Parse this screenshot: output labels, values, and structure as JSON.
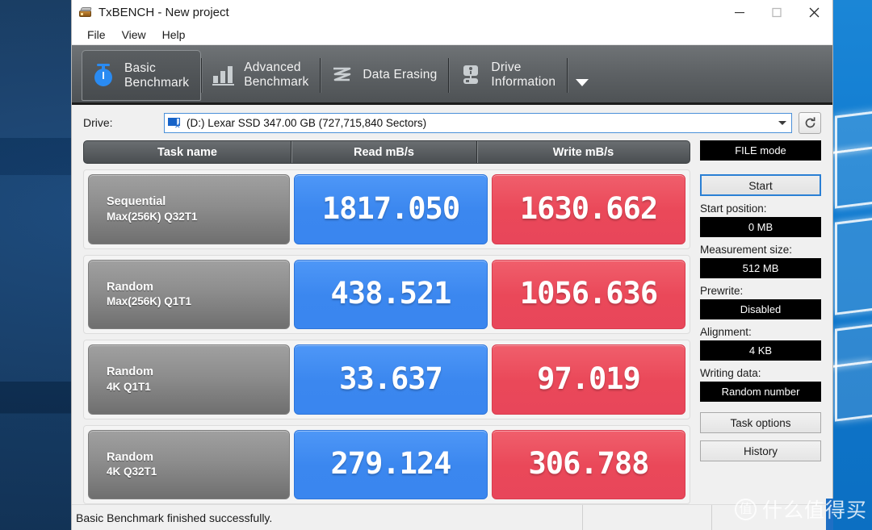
{
  "window": {
    "title": "TxBENCH - New project",
    "app_icon": "printer-drive-icon",
    "controls": {
      "minimize": "minimize-icon",
      "maximize": "maximize-icon",
      "close": "close-icon"
    }
  },
  "menubar": {
    "items": [
      "File",
      "View",
      "Help"
    ]
  },
  "toolbar": {
    "tabs": [
      {
        "label": "Basic\nBenchmark",
        "icon": "stopwatch-icon",
        "active": true
      },
      {
        "label": "Advanced\nBenchmark",
        "icon": "bar-chart-icon",
        "active": false
      },
      {
        "label": "Data Erasing",
        "icon": "zigzag-erase-icon",
        "active": false
      },
      {
        "label": "Drive\nInformation",
        "icon": "drive-info-icon",
        "active": false
      }
    ],
    "overflow_icon": "chevron-down-icon"
  },
  "drive": {
    "label": "Drive:",
    "selected": "(D:) Lexar SSD  347.00 GB (727,715,840 Sectors)",
    "icon": "hard-drive-icon",
    "refresh_icon": "refresh-icon",
    "dropdown_icon": "chevron-down-icon"
  },
  "benchmark": {
    "columns": [
      "Task name",
      "Read mB/s",
      "Write mB/s"
    ],
    "rows": [
      {
        "name_line1": "Sequential",
        "name_line2": "Max(256K) Q32T1",
        "read": "1817.050",
        "write": "1630.662"
      },
      {
        "name_line1": "Random",
        "name_line2": "Max(256K) Q1T1",
        "read": "438.521",
        "write": "1056.636"
      },
      {
        "name_line1": "Random",
        "name_line2": "4K Q1T1",
        "read": "33.637",
        "write": "97.019"
      },
      {
        "name_line1": "Random",
        "name_line2": "4K Q32T1",
        "read": "279.124",
        "write": "306.788"
      }
    ]
  },
  "chart_data": {
    "type": "bar",
    "title": "TxBENCH Basic Benchmark results",
    "categories": [
      "Sequential Max(256K) Q32T1",
      "Random Max(256K) Q1T1",
      "Random 4K Q1T1",
      "Random 4K Q32T1"
    ],
    "series": [
      {
        "name": "Read mB/s",
        "values": [
          1817.05,
          438.521,
          33.637,
          279.124
        ],
        "color": "#3b87ef"
      },
      {
        "name": "Write mB/s",
        "values": [
          1630.662,
          1056.636,
          97.019,
          306.788
        ],
        "color": "#e8465a"
      }
    ],
    "xlabel": "Task name",
    "ylabel": "mB/s",
    "grid": false,
    "legend_position": "top"
  },
  "side_panel": {
    "mode_button": "FILE mode",
    "start_button": "Start",
    "start_position_label": "Start position:",
    "start_position_value": "0 MB",
    "measurement_size_label": "Measurement size:",
    "measurement_size_value": "512 MB",
    "prewrite_label": "Prewrite:",
    "prewrite_value": "Disabled",
    "alignment_label": "Alignment:",
    "alignment_value": "4 KB",
    "writing_data_label": "Writing data:",
    "writing_data_value": "Random number",
    "task_options_button": "Task options",
    "history_button": "History"
  },
  "statusbar": {
    "message": "Basic Benchmark finished successfully."
  },
  "watermark": {
    "logo_text": "值",
    "text": "什么值得买"
  },
  "colors": {
    "read_accent": "#3b87ef",
    "write_accent": "#e8465a",
    "toolbar_bg": "#5e6265",
    "window_bg": "#f0f0f0",
    "focus_border": "#2a7fd4"
  }
}
